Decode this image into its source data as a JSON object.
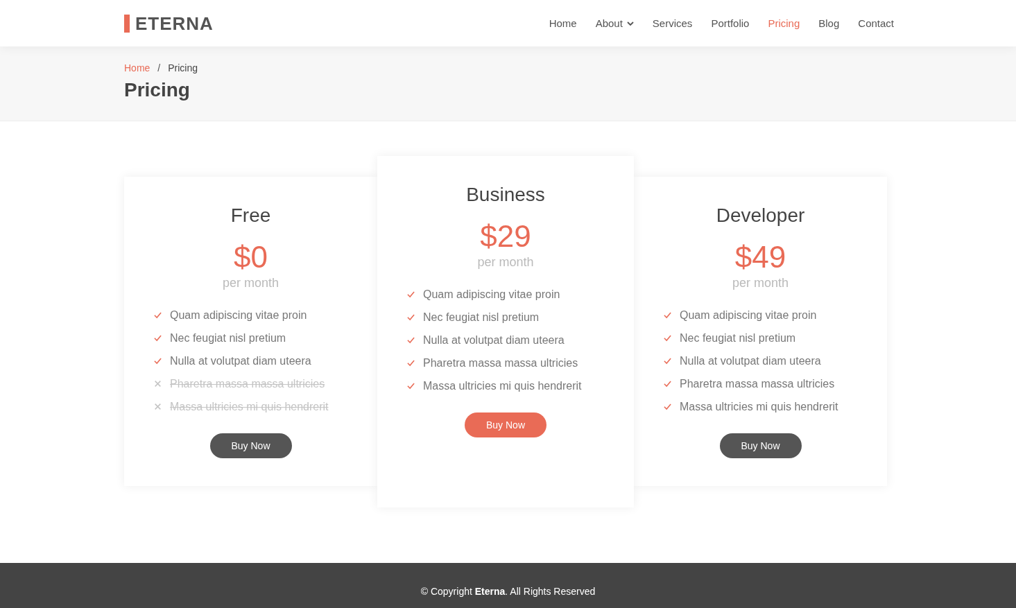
{
  "header": {
    "logo": "ETERNA",
    "nav": [
      {
        "label": "Home",
        "selected": false,
        "dropdown": false
      },
      {
        "label": "About",
        "selected": false,
        "dropdown": true
      },
      {
        "label": "Services",
        "selected": false,
        "dropdown": false
      },
      {
        "label": "Portfolio",
        "selected": false,
        "dropdown": false
      },
      {
        "label": "Pricing",
        "selected": true,
        "dropdown": false
      },
      {
        "label": "Blog",
        "selected": false,
        "dropdown": false
      },
      {
        "label": "Contact",
        "selected": false,
        "dropdown": false
      }
    ]
  },
  "breadcrumb": {
    "items": [
      {
        "label": "Home",
        "kind": "link"
      },
      {
        "label": "/",
        "kind": "separator"
      },
      {
        "label": "Pricing",
        "kind": "current"
      }
    ],
    "title": "Pricing"
  },
  "plans": [
    {
      "name": "Free",
      "price": "$0",
      "period": "per month",
      "featured": false,
      "features": [
        {
          "text": "Quam adipiscing vitae proin",
          "included": true
        },
        {
          "text": "Nec feugiat nisl pretium",
          "included": true
        },
        {
          "text": "Nulla at volutpat diam uteera",
          "included": true
        },
        {
          "text": "Pharetra massa massa ultricies",
          "included": false
        },
        {
          "text": "Massa ultricies mi quis hendrerit",
          "included": false
        }
      ],
      "button": "Buy Now"
    },
    {
      "name": "Business",
      "price": "$29",
      "period": "per month",
      "featured": true,
      "features": [
        {
          "text": "Quam adipiscing vitae proin",
          "included": true
        },
        {
          "text": "Nec feugiat nisl pretium",
          "included": true
        },
        {
          "text": "Nulla at volutpat diam uteera",
          "included": true
        },
        {
          "text": "Pharetra massa massa ultricies",
          "included": true
        },
        {
          "text": "Massa ultricies mi quis hendrerit",
          "included": true
        }
      ],
      "button": "Buy Now"
    },
    {
      "name": "Developer",
      "price": "$49",
      "period": "per month",
      "featured": false,
      "features": [
        {
          "text": "Quam adipiscing vitae proin",
          "included": true
        },
        {
          "text": "Nec feugiat nisl pretium",
          "included": true
        },
        {
          "text": "Nulla at volutpat diam uteera",
          "included": true
        },
        {
          "text": "Pharetra massa massa ultricies",
          "included": true
        },
        {
          "text": "Massa ultricies mi quis hendrerit",
          "included": true
        }
      ],
      "button": "Buy Now"
    }
  ],
  "footer": {
    "text": "© Copyright **Eterna**. All Rights Reserved"
  }
}
